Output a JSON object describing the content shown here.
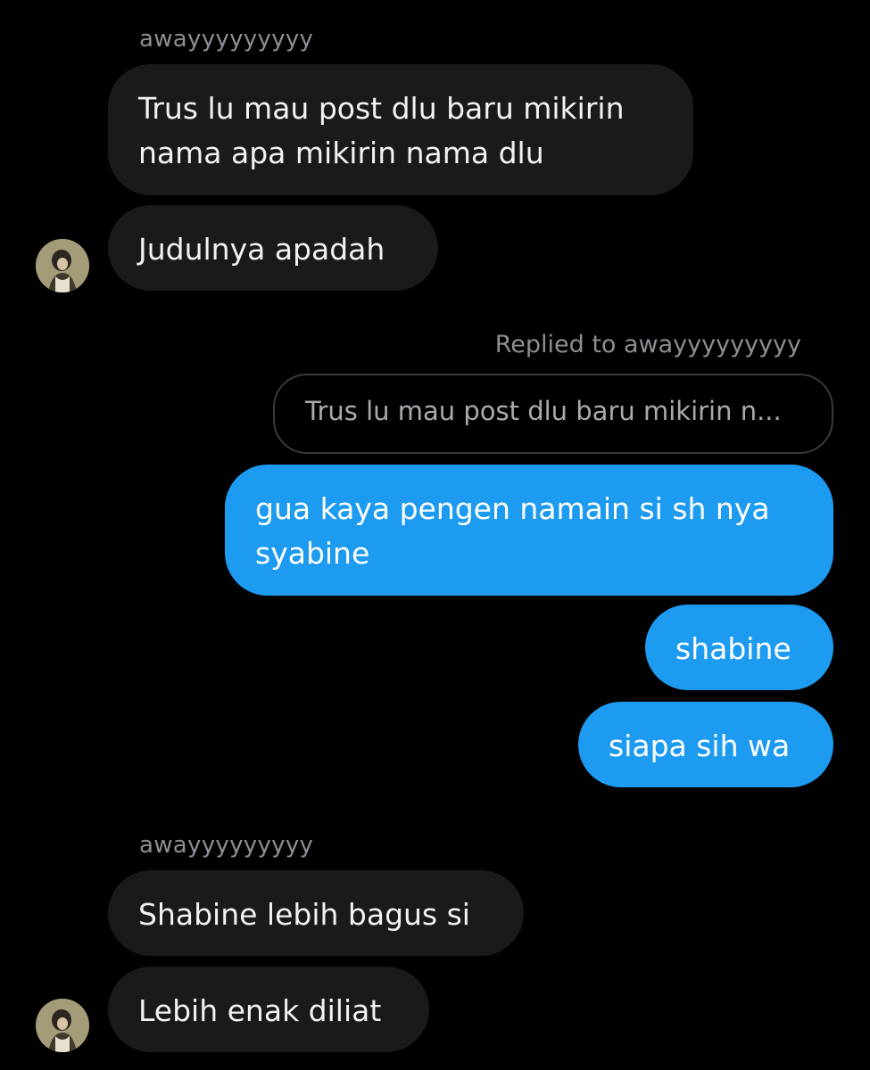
{
  "conversation": {
    "group1": {
      "sender_name": "awayyyyyyyyy",
      "messages": [
        "Trus lu mau post dlu baru mikirin nama apa mikirin nama dlu",
        "Judulnya apadah"
      ]
    },
    "reply": {
      "label": "Replied to awayyyyyyyyy",
      "quoted_text": "Trus lu mau post dlu baru mikirin n..."
    },
    "outgoing": [
      "gua kaya pengen namain si sh nya syabine",
      "shabine",
      "siapa sih wa"
    ],
    "group2": {
      "sender_name": "awayyyyyyyyy",
      "messages": [
        "Shabine lebih bagus si",
        "Lebih enak diliat"
      ]
    }
  },
  "colors": {
    "background": "#000000",
    "incoming_bubble": "#1a1a1a",
    "outgoing_bubble": "#1d9bf0",
    "muted_text": "#8b8f94"
  },
  "icons": {
    "avatar": "user-avatar-photo"
  }
}
